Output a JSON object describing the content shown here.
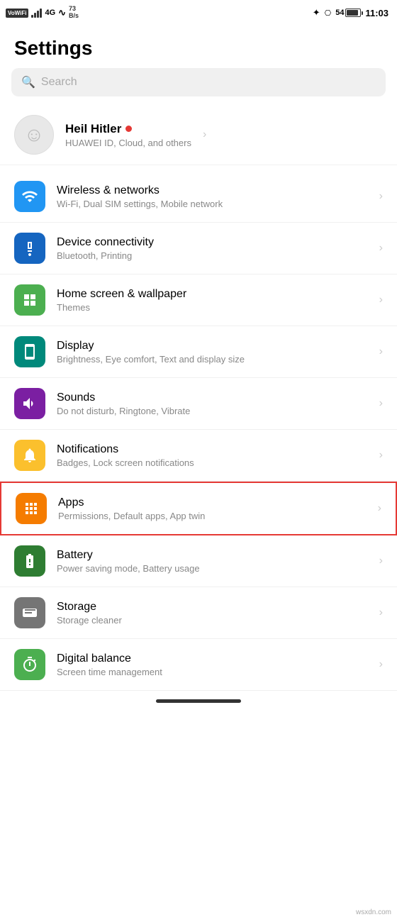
{
  "statusBar": {
    "leftItems": {
      "vowifi": "VoWiFi",
      "network": "4G",
      "speed": "73\nB/s"
    },
    "rightItems": {
      "battery": "54",
      "time": "11:03"
    }
  },
  "pageTitle": "Settings",
  "search": {
    "placeholder": "Search"
  },
  "profile": {
    "name": "Heil Hitler",
    "subtitle": "HUAWEI ID, Cloud, and others"
  },
  "settingsItems": [
    {
      "id": "wireless",
      "icon": "wifi",
      "iconColor": "icon-blue",
      "title": "Wireless & networks",
      "subtitle": "Wi-Fi, Dual SIM settings, Mobile network"
    },
    {
      "id": "device-connectivity",
      "icon": "devices",
      "iconColor": "icon-blue2",
      "title": "Device connectivity",
      "subtitle": "Bluetooth, Printing"
    },
    {
      "id": "home-screen",
      "icon": "home",
      "iconColor": "icon-green",
      "title": "Home screen & wallpaper",
      "subtitle": "Themes"
    },
    {
      "id": "display",
      "icon": "display",
      "iconColor": "icon-teal",
      "title": "Display",
      "subtitle": "Brightness, Eye comfort, Text and display size"
    },
    {
      "id": "sounds",
      "icon": "sound",
      "iconColor": "icon-purple",
      "title": "Sounds",
      "subtitle": "Do not disturb, Ringtone, Vibrate"
    },
    {
      "id": "notifications",
      "icon": "bell",
      "iconColor": "icon-yellow",
      "title": "Notifications",
      "subtitle": "Badges, Lock screen notifications"
    },
    {
      "id": "apps",
      "icon": "apps",
      "iconColor": "icon-orange",
      "title": "Apps",
      "subtitle": "Permissions, Default apps, App twin",
      "highlighted": true
    },
    {
      "id": "battery",
      "icon": "battery",
      "iconColor": "icon-green2",
      "title": "Battery",
      "subtitle": "Power saving mode, Battery usage"
    },
    {
      "id": "storage",
      "icon": "storage",
      "iconColor": "icon-gray",
      "title": "Storage",
      "subtitle": "Storage cleaner"
    },
    {
      "id": "digital-balance",
      "icon": "timer",
      "iconColor": "icon-green",
      "title": "Digital balance",
      "subtitle": "Screen time management"
    }
  ],
  "watermark": "wsxdn.com"
}
